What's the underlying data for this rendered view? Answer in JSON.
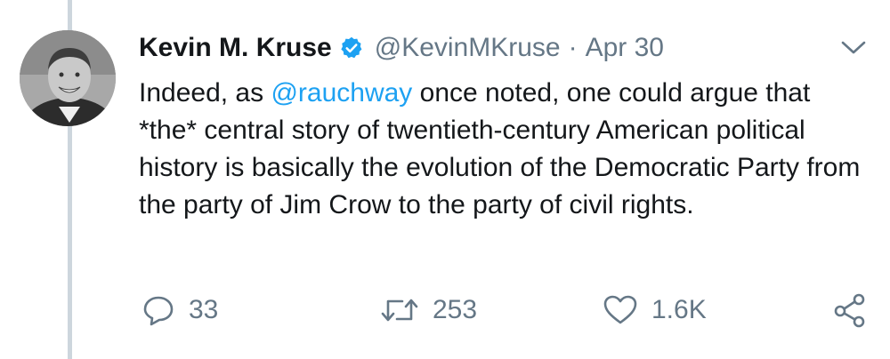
{
  "author": {
    "name": "Kevin M. Kruse",
    "handle": "@KevinMKruse",
    "separator": "·",
    "date": "Apr 30"
  },
  "tweet": {
    "text_before": "Indeed, as ",
    "mention": "@rauchway",
    "text_after": " once noted, one could argue that *the* central story of twentieth-century American political history is basically the evolution of the Democratic Party from the party of Jim Crow to the party of civil rights."
  },
  "actions": {
    "reply_count": "33",
    "retweet_count": "253",
    "like_count": "1.6K"
  },
  "colors": {
    "link": "#1da1f2",
    "muted": "#657786",
    "text": "#14171a",
    "thread_line": "#cdd6dd"
  },
  "icons": [
    "verified-badge-icon",
    "chevron-down-icon",
    "reply-icon",
    "retweet-icon",
    "like-icon",
    "share-icon"
  ]
}
